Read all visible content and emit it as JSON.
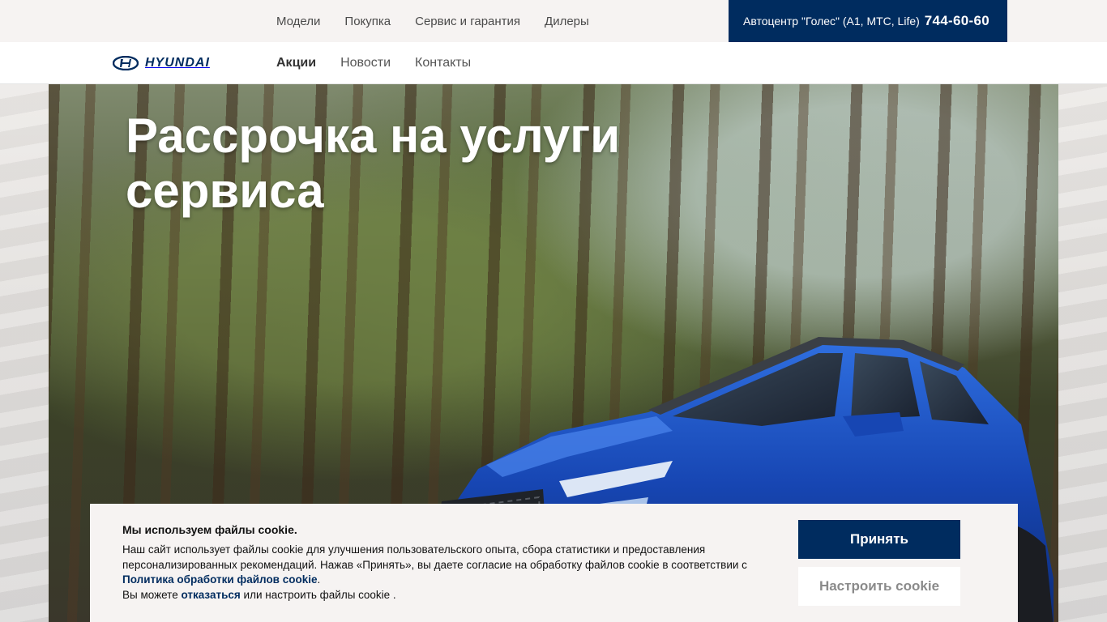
{
  "top_nav": {
    "items": [
      "Модели",
      "Покупка",
      "Сервис и гарантия",
      "Дилеры"
    ]
  },
  "dealer": {
    "name": "Автоцентр \"Голес\" (A1, МТС, Life)",
    "phone": "744-60-60"
  },
  "brand": {
    "logo_text": "HYUNDAI"
  },
  "main_nav": {
    "items": [
      "Акции",
      "Новости",
      "Контакты"
    ],
    "active": "Акции"
  },
  "hero": {
    "title": "Рассрочка на услуги сервиса"
  },
  "cookie_banner": {
    "title": "Мы используем файлы cookie.",
    "text_part1": "Наш сайт использует файлы cookie для улучшения пользовательского опыта, сбора статистики и предоставления персонализированных рекомендаций. Нажав «Принять», вы даете согласие на обработку файлов cookie в соответствии с ",
    "policy_link": "Политика обработки файлов cookie",
    "text_part2": ".",
    "text_part3": "Вы можете ",
    "refuse_link": "отказаться",
    "text_part4": " или настроить файлы cookie .",
    "accept_label": "Принять",
    "settings_label": "Настроить cookie"
  },
  "colors": {
    "brand_navy": "#002c5f",
    "banner_bg": "#f6f3f2"
  }
}
